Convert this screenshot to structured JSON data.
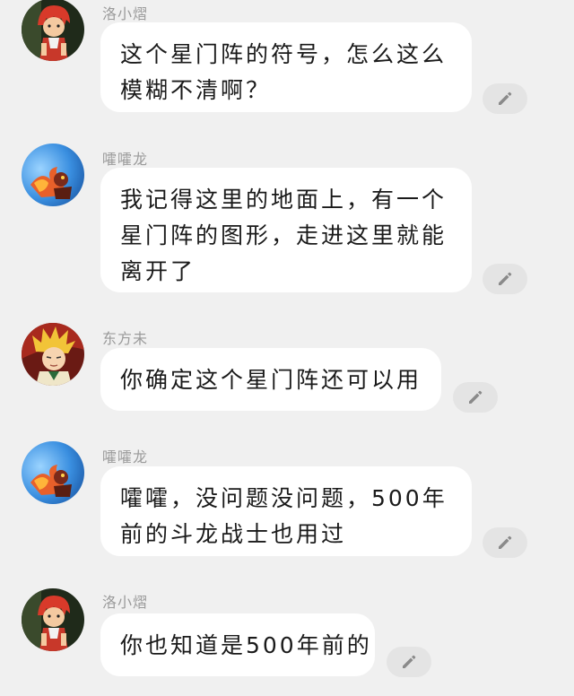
{
  "messages": [
    {
      "sender": "洛小熠",
      "avatar_icon": "red-haired-boy-avatar",
      "lines": [
        "这个星门阵的符号，怎么这么",
        "模糊不清啊？"
      ]
    },
    {
      "sender": "嚯嚯龙",
      "avatar_icon": "blue-flame-dragon-avatar",
      "lines": [
        "我记得这里的地面上，有一个",
        "星门阵的图形，走进这里就能",
        "离开了"
      ]
    },
    {
      "sender": "东方未",
      "avatar_icon": "blonde-spiky-hair-avatar",
      "lines": [
        "你确定这个星门阵还可以用"
      ]
    },
    {
      "sender": "嚯嚯龙",
      "avatar_icon": "blue-flame-dragon-avatar",
      "lines": [
        "嚯嚯，没问题没问题，500年",
        "前的斗龙战士也用过"
      ]
    },
    {
      "sender": "洛小熠",
      "avatar_icon": "red-haired-boy-avatar",
      "lines": [
        "你也知道是500年前的"
      ]
    }
  ],
  "edit_icon": "pencil-icon",
  "colors": {
    "background": "#f0f0f0",
    "bubble": "#ffffff",
    "edit_button": "#e4e4e4",
    "name_text": "#9a9a9a"
  }
}
